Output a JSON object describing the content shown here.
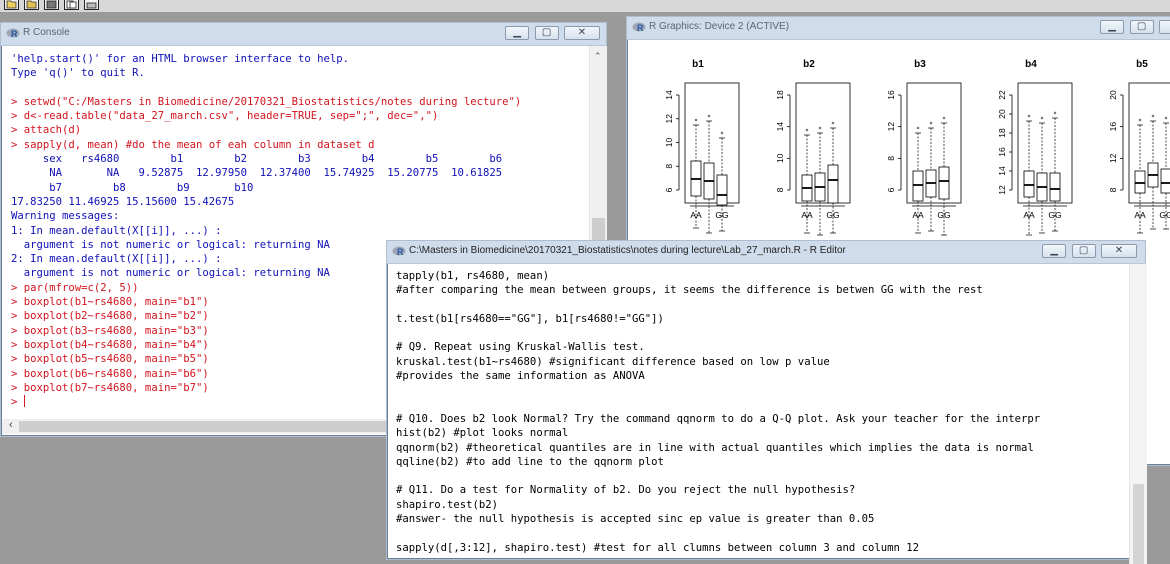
{
  "toolbar": {
    "buttons": [
      "open-script-icon",
      "load-workspace-icon",
      "save-icon",
      "copy-icon",
      "print-icon"
    ]
  },
  "console": {
    "title": "R Console",
    "lines": [
      {
        "text": "'help.start()' for an HTML browser interface to help.",
        "color": "blue"
      },
      {
        "text": "Type 'q()' to quit R.",
        "color": "blue"
      },
      {
        "text": "",
        "color": "blue"
      },
      {
        "text": "> setwd(\"C:/Masters in Biomedicine/20170321_Biostatistics/notes during lecture\")",
        "color": "red"
      },
      {
        "text": "> d<-read.table(\"data_27_march.csv\", header=TRUE, sep=\";\", dec=\",\")",
        "color": "red"
      },
      {
        "text": "> attach(d)",
        "color": "red"
      },
      {
        "text": "> sapply(d, mean) #do the mean of eah column in dataset d",
        "color": "red"
      },
      {
        "text": "     sex   rs4680        b1        b2        b3        b4        b5        b6",
        "color": "blue"
      },
      {
        "text": "      NA       NA   9.52875  12.97950  12.37400  15.74925  15.20775  10.61825",
        "color": "blue"
      },
      {
        "text": "      b7        b8        b9       b10",
        "color": "blue"
      },
      {
        "text": "17.83250 11.46925 15.15600 15.42675",
        "color": "blue"
      },
      {
        "text": "Warning messages:",
        "color": "blue"
      },
      {
        "text": "1: In mean.default(X[[i]], ...) :",
        "color": "blue"
      },
      {
        "text": "  argument is not numeric or logical: returning NA",
        "color": "blue"
      },
      {
        "text": "2: In mean.default(X[[i]], ...) :",
        "color": "blue"
      },
      {
        "text": "  argument is not numeric or logical: returning NA",
        "color": "blue"
      },
      {
        "text": "> par(mfrow=c(2, 5))",
        "color": "red"
      },
      {
        "text": "> boxplot(b1~rs4680, main=\"b1\")",
        "color": "red"
      },
      {
        "text": "> boxplot(b2~rs4680, main=\"b2\")",
        "color": "red"
      },
      {
        "text": "> boxplot(b3~rs4680, main=\"b3\")",
        "color": "red"
      },
      {
        "text": "> boxplot(b4~rs4680, main=\"b4\")",
        "color": "red"
      },
      {
        "text": "> boxplot(b5~rs4680, main=\"b5\")",
        "color": "red"
      },
      {
        "text": "> boxplot(b6~rs4680, main=\"b6\")",
        "color": "red"
      },
      {
        "text": "> boxplot(b7~rs4680, main=\"b7\")",
        "color": "red"
      },
      {
        "text": "> ",
        "color": "red",
        "cursor": true
      }
    ]
  },
  "graphics": {
    "title": "R Graphics: Device 2 (ACTIVE)",
    "panels": [
      {
        "main": "b1",
        "ticks": [
          "6",
          "8",
          "10",
          "12",
          "14"
        ],
        "xlabels": [
          "AA",
          "GG"
        ]
      },
      {
        "main": "b2",
        "ticks": [
          "8",
          "10",
          "14",
          "18"
        ],
        "xlabels": [
          "AA",
          "GG"
        ]
      },
      {
        "main": "b3",
        "ticks": [
          "6",
          "8",
          "12",
          "16"
        ],
        "xlabels": [
          "AA",
          "GG"
        ]
      },
      {
        "main": "b4",
        "ticks": [
          "12",
          "14",
          "16",
          "18",
          "20",
          "22"
        ],
        "xlabels": [
          "AA",
          "GG"
        ]
      },
      {
        "main": "b5",
        "ticks": [
          "8",
          "12",
          "16",
          "20"
        ],
        "xlabels": [
          "AA",
          "GG"
        ]
      }
    ]
  },
  "editor": {
    "title": "C:\\Masters in Biomedicine\\20170321_Biostatistics\\notes during lecture\\Lab_27_march.R - R Editor",
    "lines": [
      "tapply(b1, rs4680, mean)",
      "#after comparing the mean between groups, it seems the difference is betwen GG with the rest",
      "",
      "t.test(b1[rs4680==\"GG\"], b1[rs4680!=\"GG\"])",
      "",
      "# Q9. Repeat using Kruskal-Wallis test.",
      "kruskal.test(b1~rs4680) #significant difference based on low p value",
      "#provides the same information as ANOVA",
      "",
      "",
      "# Q10. Does b2 look Normal? Try the command qqnorm to do a Q-Q plot. Ask your teacher for the interpr",
      "hist(b2) #plot looks normal",
      "qqnorm(b2) #theoretical quantiles are in line with actual quantiles which implies the data is normal",
      "qqline(b2) #to add line to the qqnorm plot",
      "",
      "# Q11. Do a test for Normality of b2. Do you reject the null hypothesis?",
      "shapiro.test(b2)",
      "#answer- the null hypothesis is accepted sinc ep value is greater than 0.05",
      "",
      "sapply(d[,3:12], shapiro.test) #test for all clumns between column 3 and column 12"
    ]
  },
  "colors": {
    "console_output": "#1010b8",
    "console_input": "#d2141e",
    "titlebar": "#cfdcec"
  }
}
